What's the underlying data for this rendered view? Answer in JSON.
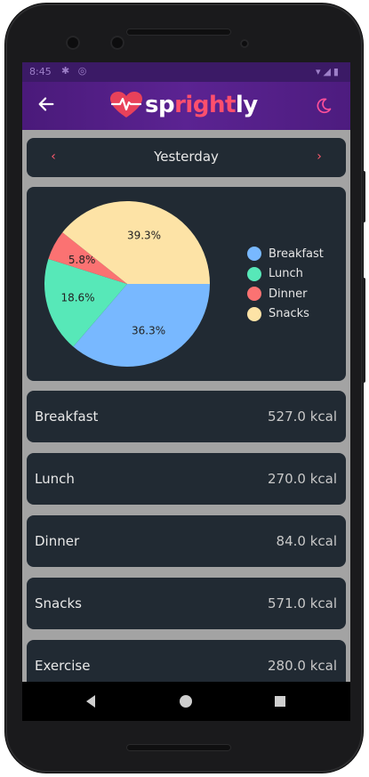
{
  "status_bar": {
    "time": "8:45"
  },
  "app_bar": {
    "logo_text_pre": "sp",
    "logo_text_accent": "right",
    "logo_text_post": "ly",
    "back_icon": "arrow-left-icon",
    "theme_icon": "moon-icon"
  },
  "date_nav": {
    "label": "Yesterday",
    "prev_icon": "chevron-left-icon",
    "next_icon": "chevron-right-icon"
  },
  "chart_data": {
    "type": "pie",
    "slices": [
      {
        "name": "Breakfast",
        "value": 36.3,
        "label": "36.3%",
        "color": "#78b8ff"
      },
      {
        "name": "Lunch",
        "value": 18.6,
        "label": "18.6%",
        "color": "#57e8b8"
      },
      {
        "name": "Dinner",
        "value": 5.8,
        "label": "5.8%",
        "color": "#fb7272"
      },
      {
        "name": "Snacks",
        "value": 39.3,
        "label": "39.3%",
        "color": "#fde3a6"
      }
    ],
    "legend_position": "right"
  },
  "meals": [
    {
      "name": "Breakfast",
      "kcal": "527.0 kcal"
    },
    {
      "name": "Lunch",
      "kcal": "270.0 kcal"
    },
    {
      "name": "Dinner",
      "kcal": "84.0 kcal"
    },
    {
      "name": "Snacks",
      "kcal": "571.0 kcal"
    },
    {
      "name": "Exercise",
      "kcal": "280.0 kcal"
    }
  ],
  "colors": {
    "app_bar": "#5b2392",
    "card": "#212a33",
    "accent": "#ff5a6e"
  }
}
